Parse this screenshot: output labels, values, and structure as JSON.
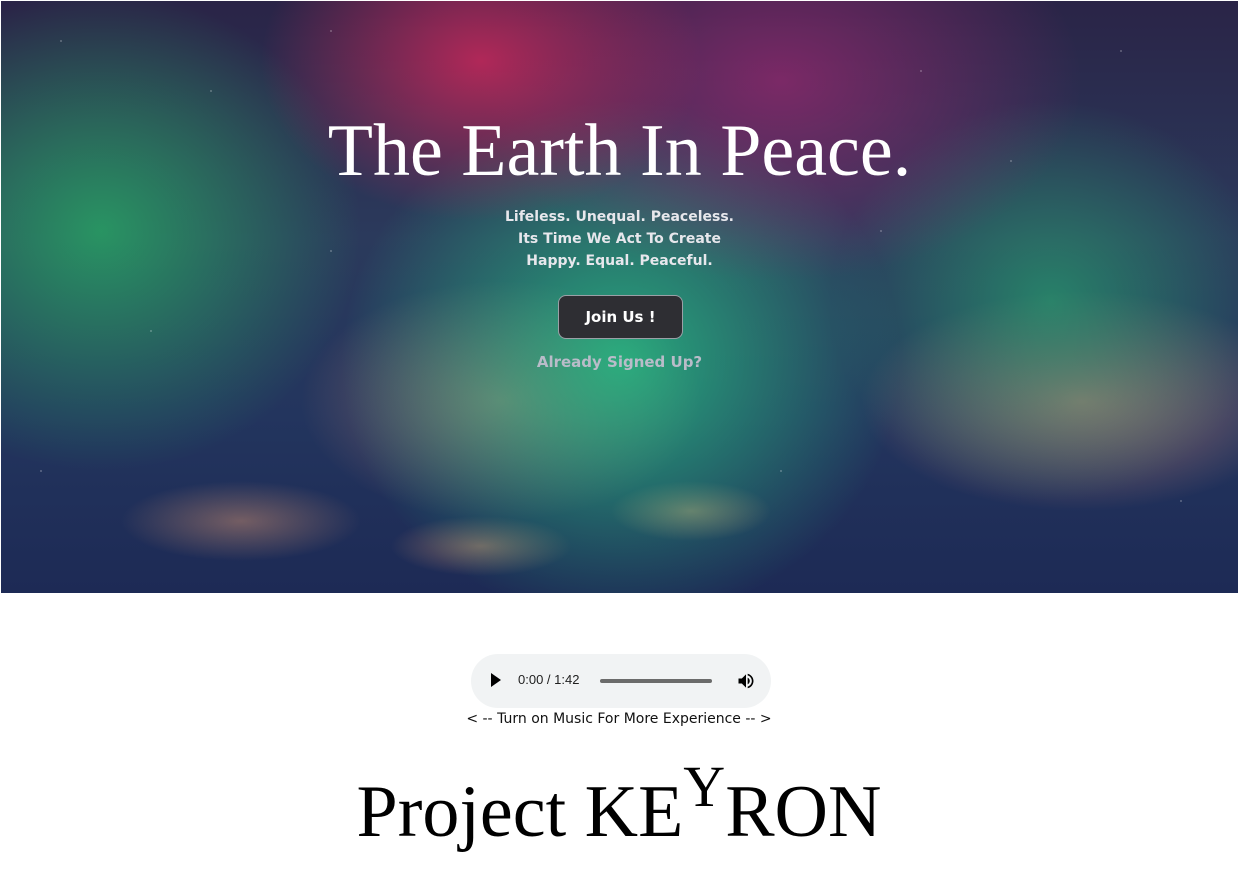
{
  "hero": {
    "title": "The Earth In Peace.",
    "tagline": [
      "Lifeless. Unequal. Peaceless.",
      "Its Time We Act To Create",
      "Happy. Equal. Peaceful."
    ],
    "join_label": "Join Us !",
    "signed_up_label": "Already Signed Up?"
  },
  "audio": {
    "time": "0:00 / 1:42",
    "progress": 0,
    "play_icon": "play-icon",
    "volume_icon": "volume-icon"
  },
  "music_hint": "< -- Turn on Music For More Experience -- >",
  "brand": {
    "part1": "Project KE",
    "sup": "Y",
    "part2": "RON"
  }
}
